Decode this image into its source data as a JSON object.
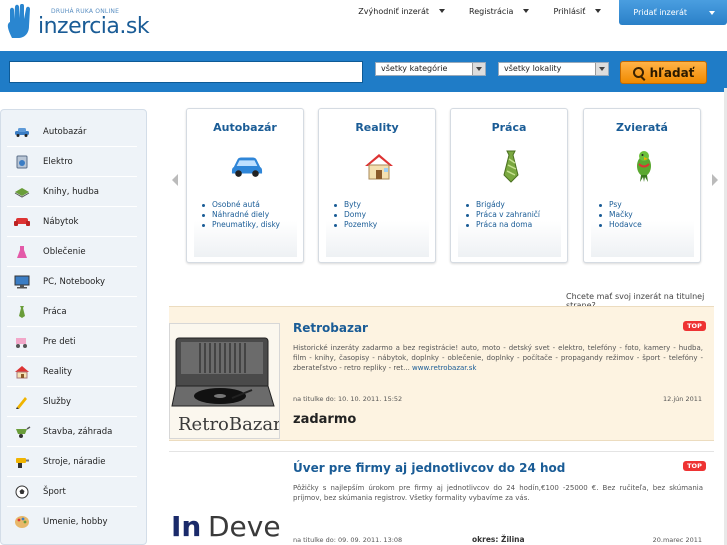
{
  "header": {
    "logo_tagline": "Druhá ruka online",
    "logo_name": "inzercia.sk",
    "nav": [
      {
        "label": "Zvýhodniť inzerát"
      },
      {
        "label": "Registrácia"
      },
      {
        "label": "Prihlásiť"
      }
    ],
    "add_label": "Pridať inzerát"
  },
  "search": {
    "input_value": "",
    "category_select": "všetky kategórie",
    "location_select": "všetky lokality",
    "button_label": "hľadať"
  },
  "sidebar": {
    "items": [
      {
        "label": "Autobazár",
        "icon": "car-icon"
      },
      {
        "label": "Elektro",
        "icon": "appliance-icon"
      },
      {
        "label": "Knihy, hudba",
        "icon": "book-icon"
      },
      {
        "label": "Nábytok",
        "icon": "sofa-icon"
      },
      {
        "label": "Oblečenie",
        "icon": "dress-icon"
      },
      {
        "label": "PC, Notebooky",
        "icon": "monitor-icon"
      },
      {
        "label": "Práca",
        "icon": "tie-icon"
      },
      {
        "label": "Pre deti",
        "icon": "stroller-icon"
      },
      {
        "label": "Reality",
        "icon": "house-icon"
      },
      {
        "label": "Služby",
        "icon": "pencil-icon"
      },
      {
        "label": "Stavba, záhrada",
        "icon": "wheelbarrow-icon"
      },
      {
        "label": "Stroje, náradie",
        "icon": "drill-icon"
      },
      {
        "label": "Šport",
        "icon": "ball-icon"
      },
      {
        "label": "Umenie, hobby",
        "icon": "palette-icon"
      }
    ]
  },
  "categories": [
    {
      "title": "Autobazár",
      "icon": "car-icon",
      "links": [
        "Osobné autá",
        "Náhradné diely",
        "Pneumatiky, disky"
      ]
    },
    {
      "title": "Reality",
      "icon": "house-icon",
      "links": [
        "Byty",
        "Domy",
        "Pozemky"
      ]
    },
    {
      "title": "Práca",
      "icon": "tie-icon",
      "links": [
        "Brigády",
        "Práca v zahraničí",
        "Práca na doma"
      ]
    },
    {
      "title": "Zvieratá",
      "icon": "parrot-icon",
      "links": [
        "Psy",
        "Mačky",
        "Hodavce"
      ]
    }
  ],
  "promo_text": "Chcete mať svoj inzerát na titulnej strane?",
  "listings": [
    {
      "title": "Retrobazar",
      "badge": "TOP",
      "thumb_text": "RetroBazar",
      "description": "Historické inzeráty zadarmo a bez registrácie! auto, moto - detský svet - elektro, telefóny - foto, kamery - hudba, film - knihy, časopisy - nábytok, doplnky - oblečenie, doplnky - počítače - propagandy režimov - šport - telefóny - zberateľstvo - retro repliky - ret...",
      "link": "www.retrobazar.sk",
      "meta": "na titulke do: 10. 10. 2011. 15:52",
      "date": "12.jún 2011",
      "price": "zadarmo"
    },
    {
      "title": "Úver pre firmy aj jednotlivcov do 24 hod",
      "badge": "TOP",
      "thumb_text_a": "In",
      "thumb_text_b": "Devel",
      "description": "Pôžičky s najlepším úrokom pre firmy aj jednotlivcov do 24 hodín,€100 -25000 €. Bez ručiteľa, bez skúmania príjmov, bez skúmania registrov. Všetky formality vybavíme za vás.",
      "meta": "na titulke do: 09. 09. 2011. 13:08",
      "location": "okres: Žilina",
      "date": "20.marec 2011"
    }
  ],
  "colors": {
    "brand_blue": "#1f7cc7",
    "link_blue": "#1a5c96",
    "search_orange": "#f08a00",
    "top_badge": "#ee3333",
    "highlight_bg": "#fdf3e1"
  }
}
